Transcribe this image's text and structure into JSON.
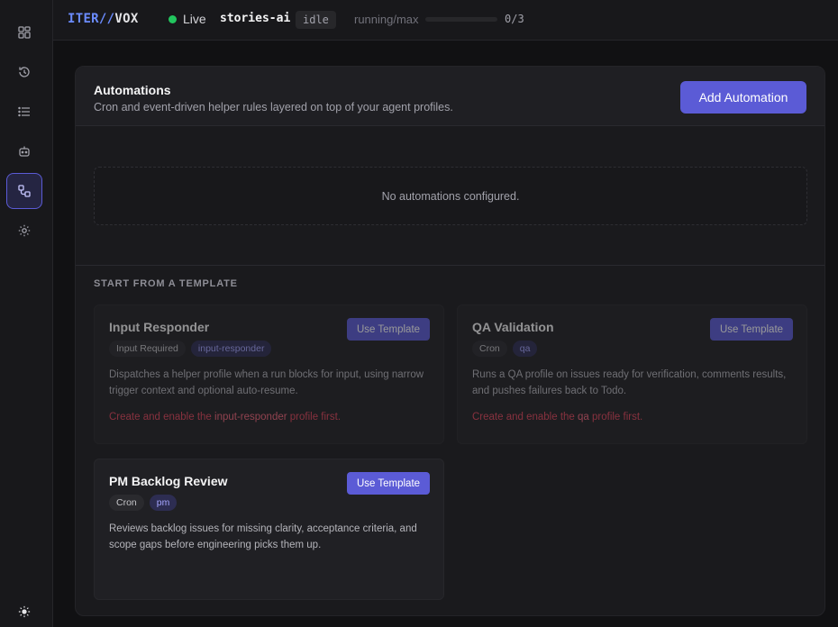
{
  "brand": {
    "part1": "ITER",
    "slashes": "//",
    "part2": "VOX"
  },
  "topbar": {
    "live_label": "Live",
    "project": "stories-ai",
    "state": "idle",
    "running_label": "running/max",
    "running_count": "0/3",
    "running_fraction": 0
  },
  "sidebar": {
    "items": [
      {
        "icon": "dashboard-icon"
      },
      {
        "icon": "history-icon"
      },
      {
        "icon": "list-icon"
      },
      {
        "icon": "bot-icon"
      },
      {
        "icon": "automation-icon",
        "active": true
      },
      {
        "icon": "gear-icon"
      }
    ],
    "theme_icon": "sun-icon"
  },
  "automations": {
    "title": "Automations",
    "subtitle": "Cron and event-driven helper rules layered on top of your agent profiles.",
    "add_label": "Add Automation",
    "empty_text": "No automations configured."
  },
  "templates": {
    "section_label": "START FROM A TEMPLATE",
    "button_label": "Use Template",
    "items": [
      {
        "title": "Input Responder",
        "tags": [
          "Input Required",
          "input-responder"
        ],
        "description": "Dispatches a helper profile when a run blocks for input, using narrow trigger context and optional auto-resume.",
        "warning_prefix": "Create and enable the ",
        "warning_profile": "input-responder",
        "warning_suffix": " profile first."
      },
      {
        "title": "QA Validation",
        "tags": [
          "Cron",
          "qa"
        ],
        "description": "Runs a QA profile on issues ready for verification, comments results, and pushes failures back to Todo.",
        "warning_prefix": "Create and enable the ",
        "warning_profile": "qa",
        "warning_suffix": " profile first."
      },
      {
        "title": "PM Backlog Review",
        "tags": [
          "Cron",
          "pm"
        ],
        "description": "Reviews backlog issues for missing clarity, acceptance criteria, and scope gaps before engineering picks them up."
      }
    ]
  },
  "colors": {
    "accent": "#5b5bd6",
    "live": "#22c55e",
    "warning": "#e0455a",
    "background": "#111113"
  }
}
